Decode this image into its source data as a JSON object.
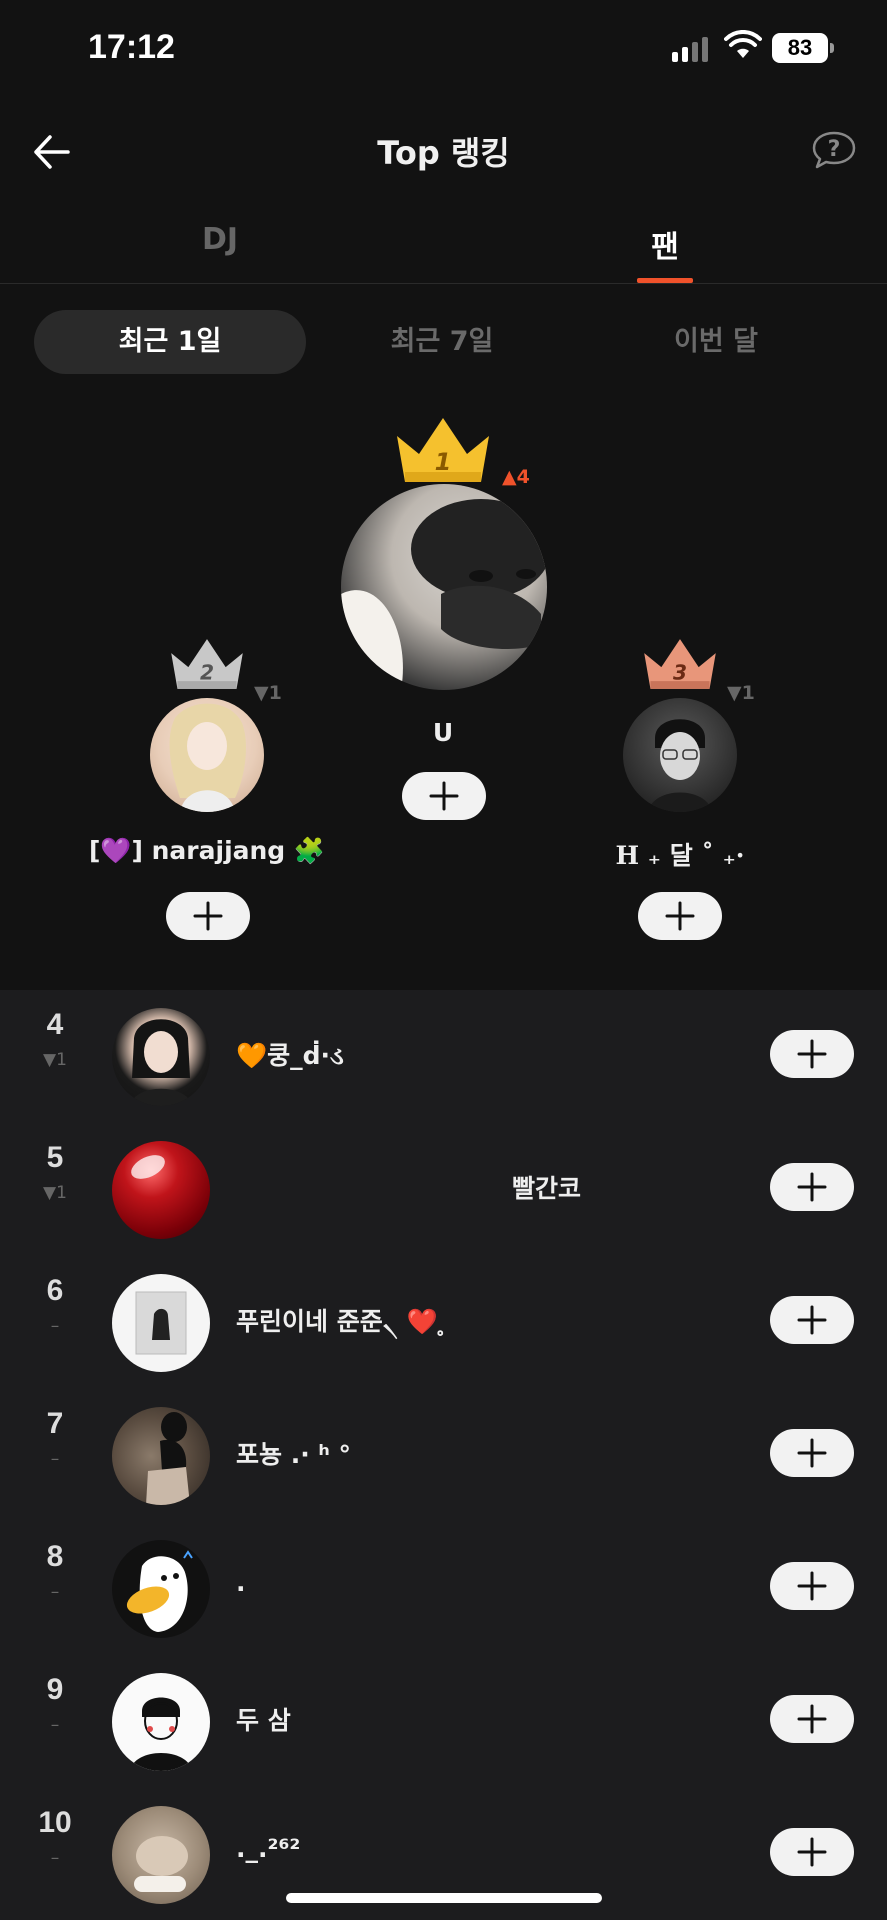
{
  "status": {
    "time": "17:12",
    "battery": "83"
  },
  "header": {
    "title": "Top 랭킹"
  },
  "tabs": [
    {
      "label": "DJ"
    },
    {
      "label": "팬"
    }
  ],
  "periods": [
    {
      "label": "최근 1일"
    },
    {
      "label": "최근 7일"
    },
    {
      "label": "이번 달"
    }
  ],
  "podium": {
    "first": {
      "rank": "1",
      "change": "▲4",
      "name": "U"
    },
    "second": {
      "rank": "2",
      "change": "▼1",
      "name": "[💜] narajjang 🧩"
    },
    "third": {
      "rank": "3",
      "change": "▼1",
      "name": "H ₊ 달 ˚ ₊·"
    }
  },
  "list": [
    {
      "rank": "4",
      "change": "▼1",
      "name": "🧡쿵_ḋ·ડ"
    },
    {
      "rank": "5",
      "change": "▼1",
      "name": "빨간코"
    },
    {
      "rank": "6",
      "change": "–",
      "name": "푸린이네 준준৲ ❤️ ̥"
    },
    {
      "rank": "7",
      "change": "–",
      "name": "포뇽 .· ʰ °"
    },
    {
      "rank": "8",
      "change": "–",
      "name": "."
    },
    {
      "rank": "9",
      "change": "–",
      "name": "두 삼"
    },
    {
      "rank": "10",
      "change": "–",
      "name": "._.²⁶²"
    }
  ],
  "colors": {
    "accent": "#f0522b",
    "gold": "#f5c12e",
    "silver": "#c8c8c8",
    "bronze": "#e8967a"
  }
}
